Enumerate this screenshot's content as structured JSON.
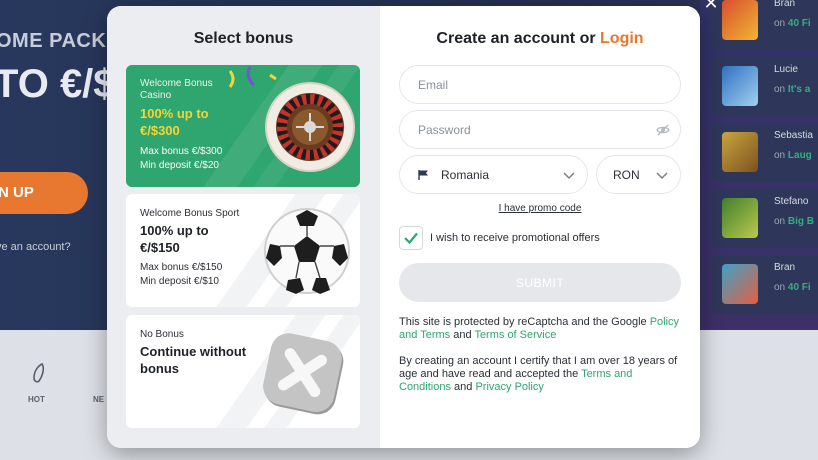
{
  "background": {
    "hero_line1": "OME PACKA",
    "hero_line2": "TO €/$",
    "signup_label": "N UP",
    "have_account": "ve an account?",
    "bottom_items": [
      "HOT",
      "NE"
    ],
    "winners": [
      {
        "name": "Bran",
        "on_prefix": "on",
        "game": "40 Fi"
      },
      {
        "name": "Lucie",
        "on_prefix": "on",
        "game": "It's a"
      },
      {
        "name": "Sebastia",
        "on_prefix": "on",
        "game": "Laug"
      },
      {
        "name": "Stefano",
        "on_prefix": "on",
        "game": "Big B"
      },
      {
        "name": "Bran",
        "on_prefix": "on",
        "game": "40 Fi"
      }
    ]
  },
  "modal": {
    "close_glyph": "✕",
    "bonus": {
      "title": "Select bonus",
      "options": [
        {
          "line1": "Welcome Bonus",
          "line1b": "Casino",
          "amount": "100% up to €/$300",
          "max": "Max bonus €/$300",
          "min": "Min deposit €/$20"
        },
        {
          "line1": "Welcome Bonus Sport",
          "amount": "100% up to €/$150",
          "max": "Max bonus €/$150",
          "min": "Min deposit €/$10"
        },
        {
          "line1": "No Bonus",
          "amount": "Continue without bonus"
        }
      ]
    },
    "form": {
      "title": "Create an account or",
      "login_link": "Login",
      "email_placeholder": "Email",
      "password_placeholder": "Password",
      "country": "Romania",
      "currency": "RON",
      "promo_link": "I have promo code",
      "promo_checkbox_label": "I wish to receive promotional offers",
      "promo_checked": true,
      "submit_label": "SUBMIT",
      "recaptcha_text": "This site is protected by reCaptcha and the Google",
      "policy_link": "Policy and Terms",
      "and1": "and",
      "tos_link": "Terms of Service",
      "certify_text": "By creating an account I certify that I am over 18 years of age and have read and accepted the",
      "tc_link": "Terms and Conditions",
      "and2": "and",
      "privacy_link": "Privacy Policy"
    }
  },
  "colors": {
    "accent_orange": "#e8772e",
    "accent_green": "#2fa56f",
    "bonus_yellow": "#f6d436"
  }
}
